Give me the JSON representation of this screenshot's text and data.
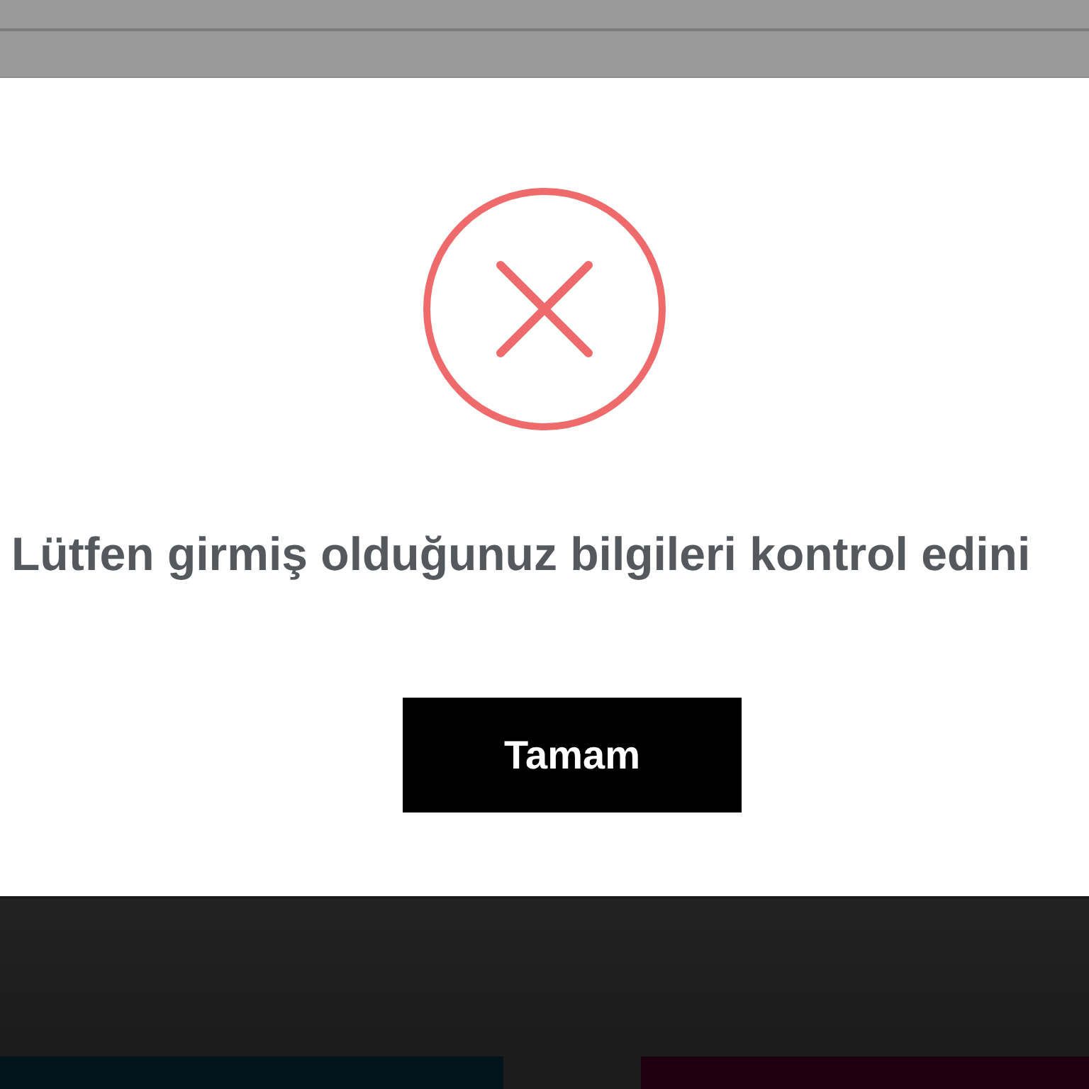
{
  "dialog": {
    "message": "Lütfen girmiş olduğunuz bilgileri kontrol edini",
    "button": "Tamam"
  }
}
